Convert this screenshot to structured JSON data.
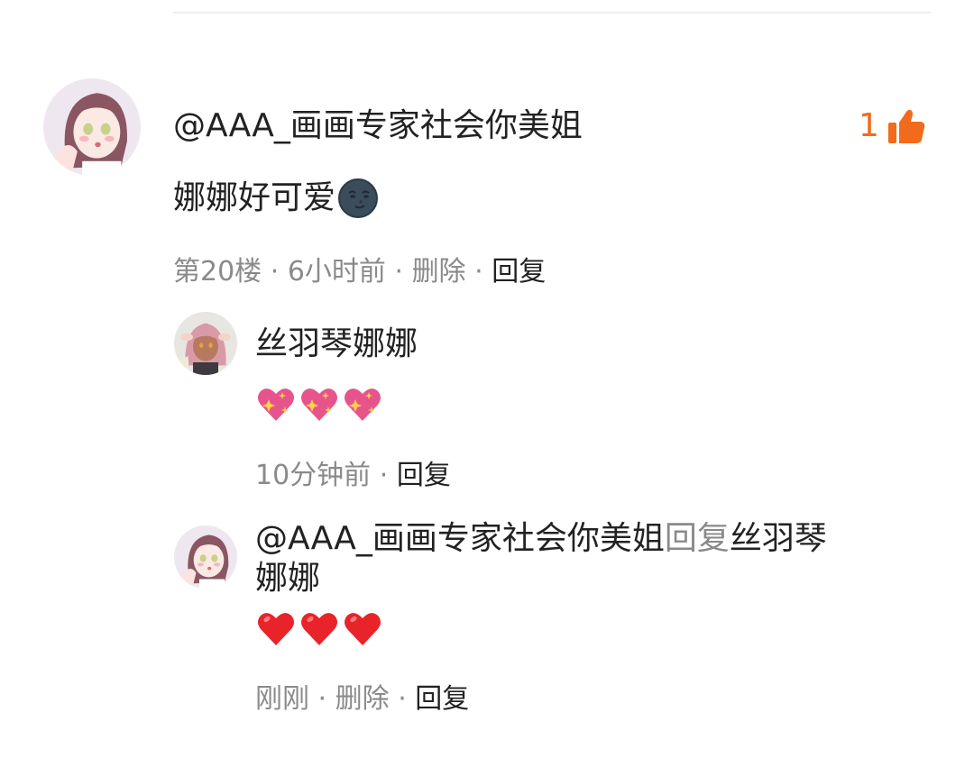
{
  "comment": {
    "author": "@AAA_画画专家社会你美姐",
    "text": "娜娜好可爱",
    "text_emoji": "new-moon-face-emoji",
    "like_count": "1",
    "floor": "第20楼",
    "time": "6小时前",
    "delete_label": "删除",
    "reply_label": "回复",
    "separator": "·"
  },
  "replies": [
    {
      "author": "丝羽琴娜娜",
      "emojis": [
        "sparkling-heart-emoji",
        "sparkling-heart-emoji",
        "sparkling-heart-emoji"
      ],
      "time": "10分钟前",
      "reply_label": "回复",
      "separator": "·"
    },
    {
      "author_line1": "@AAA_画画专家社会你美姐",
      "reply_to_word": "回复",
      "target_line1": "丝羽琴",
      "target_line2": "娜娜",
      "emojis": [
        "red-heart-emoji",
        "red-heart-emoji",
        "red-heart-emoji"
      ],
      "time": "刚刚",
      "delete_label": "删除",
      "reply_label": "回复",
      "separator": "·"
    }
  ],
  "colors": {
    "like_accent": "#f26a1b",
    "meta_gray": "#8a8a8a",
    "text": "#222222"
  }
}
